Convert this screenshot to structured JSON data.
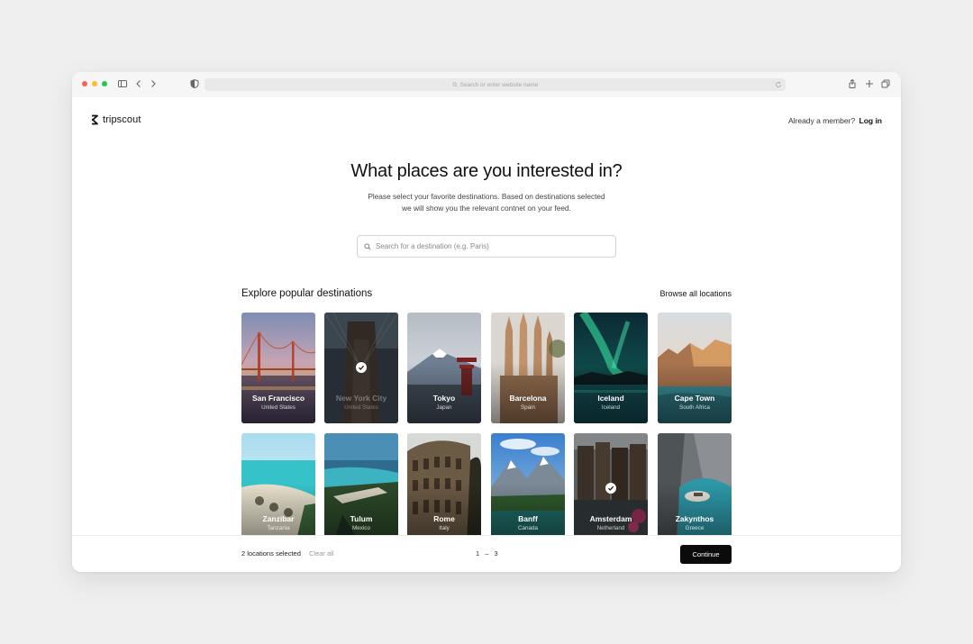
{
  "browser": {
    "address_placeholder": "Search or enter website name"
  },
  "header": {
    "logo_text": "tripscout",
    "member_prompt": "Already a member?",
    "login_label": "Log in"
  },
  "main": {
    "headline": "What places are you interested in?",
    "subtitle_line1": "Please select your favorite destinations. Based on destinations selected",
    "subtitle_line2": "we will show you the relevant contnet on your feed.",
    "search_placeholder": "Search for a destination (e.g. Paris)",
    "section_title": "Explore popular destinations",
    "browse_all": "Browse all locations"
  },
  "destinations": [
    {
      "name": "San Francisco",
      "country": "United States",
      "selected": false
    },
    {
      "name": "New York City",
      "country": "United States",
      "selected": true
    },
    {
      "name": "Tokyo",
      "country": "Japan",
      "selected": false
    },
    {
      "name": "Barcelona",
      "country": "Spain",
      "selected": false
    },
    {
      "name": "Iceland",
      "country": "Iceland",
      "selected": false
    },
    {
      "name": "Cape Town",
      "country": "South Africa",
      "selected": false
    },
    {
      "name": "Zanzibar",
      "country": "Tanzania",
      "selected": false
    },
    {
      "name": "Tulum",
      "country": "Mexico",
      "selected": false
    },
    {
      "name": "Rome",
      "country": "Italy",
      "selected": false
    },
    {
      "name": "Banff",
      "country": "Canada",
      "selected": false
    },
    {
      "name": "Amsterdam",
      "country": "Netherland",
      "selected": true
    },
    {
      "name": "Zakynthos",
      "country": "Greece",
      "selected": false
    }
  ],
  "footer": {
    "selected_count": "2 locations selected",
    "clear_all": "Clear all",
    "pagination": "1 – 3",
    "continue_label": "Continue"
  },
  "colors": {
    "accent": "#0b0b0b",
    "selected_outline": "#111111"
  }
}
